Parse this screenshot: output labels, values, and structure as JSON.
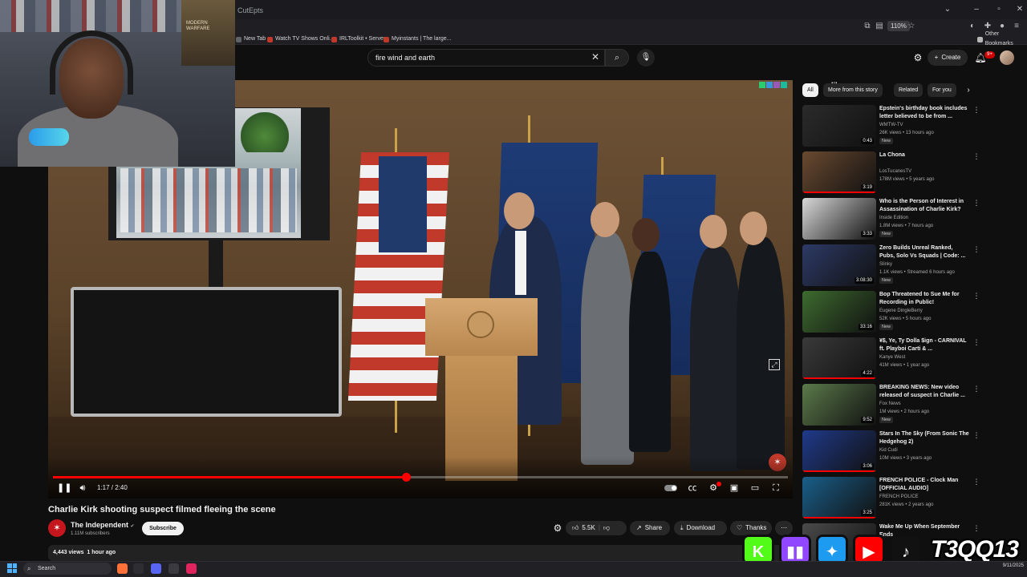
{
  "browser": {
    "partial_tab_label": "CutEpts",
    "zoom_level": "110%",
    "bookmarks": [
      {
        "label": "New Tab",
        "color": "#5f6368"
      },
      {
        "label": "Watch TV Shows Onli...",
        "color": "#c0392b"
      },
      {
        "label": "IRLToolkit • Server",
        "color": "#c0392b"
      },
      {
        "label": "Myinstants | The large...",
        "color": "#c0392b"
      }
    ],
    "other_bookmarks": "Other Bookmarks"
  },
  "masthead": {
    "search_query": "fire wind and earth",
    "create_label": "Create",
    "notification_count": "9+"
  },
  "webcam": {
    "poster_text": "MODERN WARFARE"
  },
  "player": {
    "current_time": "1:17",
    "duration": "2:40",
    "time_separator": " / ",
    "progress_fraction": 0.48,
    "overlay_tag": "lib"
  },
  "video": {
    "title": "Charlie Kirk shooting suspect filmed fleeing the scene",
    "channel_name": "The Independent",
    "subscribers": "1.11M subscribers",
    "subscribe_label": "Subscribe",
    "likes": "5.5K",
    "share_label": "Share",
    "download_label": "Download",
    "thanks_label": "Thanks",
    "views": "4,443 views",
    "posted": "1 hour ago"
  },
  "sidebar": {
    "chips": [
      {
        "label": "All",
        "active": true
      },
      {
        "label": "More from this story",
        "active": false
      },
      {
        "label": "Related",
        "active": false
      },
      {
        "label": "For you",
        "active": false
      }
    ],
    "recommendations": [
      {
        "title": "Epstein's birthday book includes letter believed to be from ...",
        "channel": "WMTW-TV",
        "stats": "26K views • 13 hours ago",
        "duration": "0:43",
        "badge": "New",
        "thumb": "#2b2b2b",
        "watched": 0
      },
      {
        "title": "La Chona",
        "channel": "LosTucanesTV",
        "stats": "178M views • 5 years ago",
        "duration": "3:19",
        "badge": "",
        "thumb": "#6a4a30",
        "watched": 1.0
      },
      {
        "title": "Who is the Person of Interest in Assassination of Charlie Kirk?",
        "channel": "Inside Edition",
        "stats": "1.8M views • 7 hours ago",
        "duration": "3:33",
        "badge": "New",
        "thumb": "#d8d8d8",
        "watched": 0
      },
      {
        "title": "Zero Builds Unreal Ranked, Pubs, Solo Vs Squads | Code: ...",
        "channel": "Slinky",
        "stats": "1.1K views • Streamed 6 hours ago",
        "duration": "3:08:30",
        "badge": "New",
        "thumb": "#2d3a66",
        "watched": 0
      },
      {
        "title": "Bop Threatened to Sue Me for Recording in Public!",
        "channel": "Eugene DingleBerry",
        "stats": "52K views • 5 hours ago",
        "duration": "33:16",
        "badge": "New",
        "thumb": "#3d6b2f",
        "watched": 0
      },
      {
        "title": "¥$, Ye, Ty Dolla $ign - CARNIVAL ft. Playboi Carti & ...",
        "channel": "Kanye West",
        "stats": "41M views • 1 year ago",
        "duration": "4:22",
        "badge": "",
        "thumb": "#3a3a3a",
        "watched": 1.0
      },
      {
        "title": "BREAKING NEWS: New video released of suspect in Charlie ...",
        "channel": "Fox News",
        "stats": "1M views • 2 hours ago",
        "duration": "9:52",
        "badge": "New",
        "thumb": "#5b7a4a",
        "watched": 0
      },
      {
        "title": "Stars In The Sky (From Sonic The Hedgehog 2)",
        "channel": "Kid Cudi",
        "stats": "10M views • 3 years ago",
        "duration": "3:06",
        "badge": "",
        "thumb": "#1f3a8a",
        "watched": 1.0
      },
      {
        "title": "FRENCH POLICE - Clock Man [OFFICIAL AUDIO]",
        "channel": "FRENCH POLICE",
        "stats": "281K views • 2 years ago",
        "duration": "3:25",
        "badge": "",
        "thumb": "#1a5f8a",
        "watched": 1.0
      },
      {
        "title": "Wake Me Up When September Ends",
        "channel": "",
        "stats": "",
        "duration": "",
        "badge": "",
        "thumb": "#4a4a4a",
        "watched": 0
      }
    ]
  },
  "social": {
    "streamer_tag": "T3QQ13",
    "icons": [
      {
        "name": "kick",
        "glyph": "K",
        "color": "#53fc18"
      },
      {
        "name": "twitch",
        "glyph": "▮▮",
        "color": "#9146ff"
      },
      {
        "name": "twitter",
        "glyph": "✦",
        "color": "#1d9bf0"
      },
      {
        "name": "youtube",
        "glyph": "▶",
        "color": "#ff0000"
      },
      {
        "name": "tiktok",
        "glyph": "♪",
        "color": "#111111"
      }
    ]
  },
  "taskbar": {
    "search_label": "Search",
    "date": "9/11/2025"
  },
  "colors": {
    "accent_red": "#ff0000",
    "background": "#0f0f0f",
    "surface": "#272727"
  }
}
